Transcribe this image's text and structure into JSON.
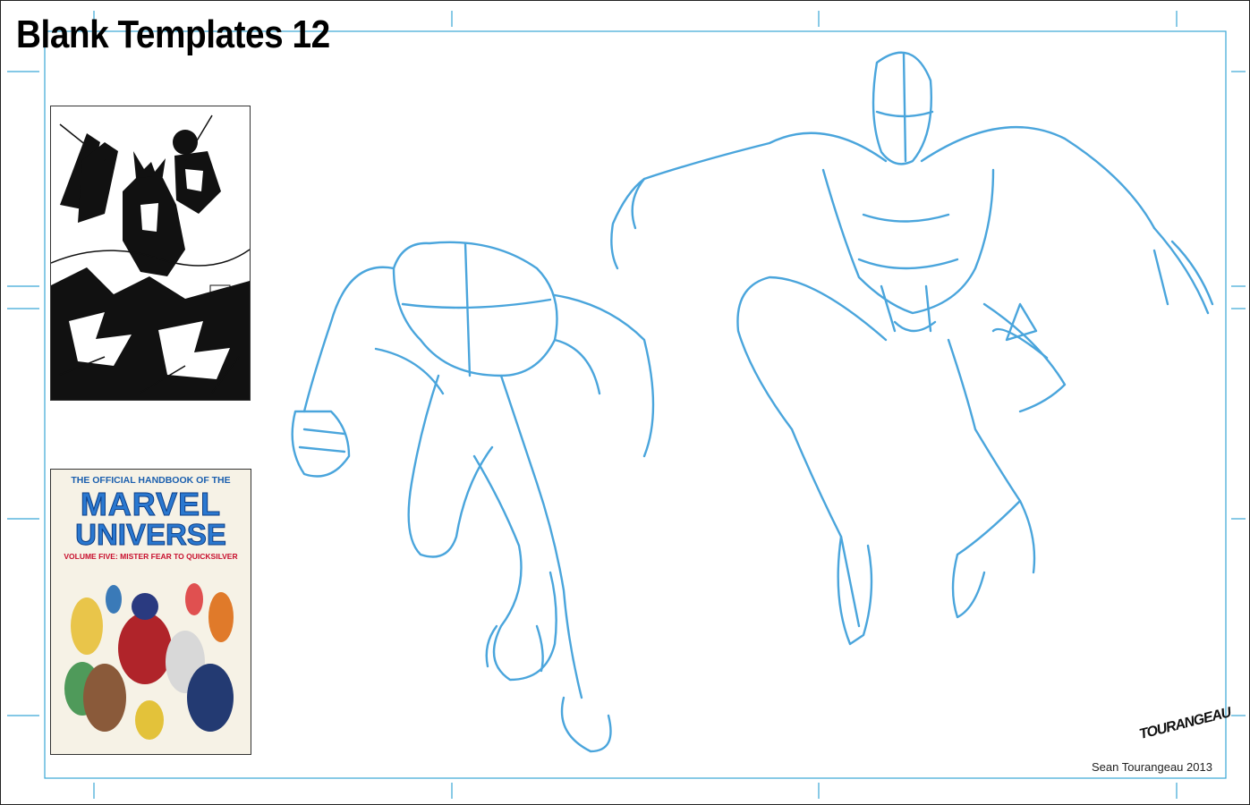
{
  "title": "Blank Templates 12",
  "thumbnail_cover": {
    "line1": "THE OFFICIAL HANDBOOK OF THE",
    "line2": "MARVEL",
    "line3": "UNIVERSE",
    "line4": "VOLUME FIVE: MISTER FEAR TO QUICKSILVER"
  },
  "signature": "TOURANGEAU",
  "credit": "Sean Tourangeau 2013",
  "colors": {
    "guide_blue": "#3aa6d6",
    "sketch_blue": "#4aa5dc",
    "frame": "#222222"
  },
  "icons": {
    "inked_thumbnail": "ink-drawing-thumbnail",
    "color_cover": "comic-cover-thumbnail",
    "sketch": "pencil-figure-sketch"
  }
}
